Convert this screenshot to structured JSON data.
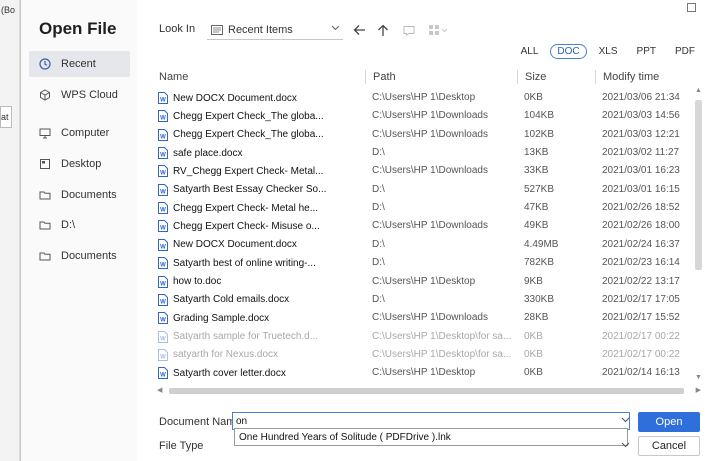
{
  "background_app": {
    "title_fragment": "(Bo",
    "field_fragment": "at"
  },
  "dialog": {
    "title": "Open File"
  },
  "sidebar": {
    "items": [
      {
        "label": "Recent",
        "icon": "clock-icon",
        "active": true
      },
      {
        "label": "WPS Cloud",
        "icon": "cube-icon",
        "active": false
      },
      {
        "label": "Computer",
        "icon": "monitor-icon",
        "active": false
      },
      {
        "label": "Desktop",
        "icon": "desktop-icon",
        "active": false
      },
      {
        "label": "Documents",
        "icon": "folder-icon",
        "active": false
      },
      {
        "label": "D:\\",
        "icon": "folder-icon",
        "active": false
      },
      {
        "label": "Documents",
        "icon": "folder-icon",
        "active": false
      }
    ]
  },
  "toolbar": {
    "look_in_label": "Look In",
    "look_in_value": "Recent Items",
    "back_icon": "arrow-left-icon",
    "up_icon": "arrow-up-icon",
    "new_folder_icon": "new-folder-icon",
    "view_icon": "view-grid-icon"
  },
  "filters": [
    "ALL",
    "DOC",
    "XLS",
    "PPT",
    "PDF"
  ],
  "active_filter": "DOC",
  "columns": {
    "name": "Name",
    "path": "Path",
    "size": "Size",
    "modified": "Modify time"
  },
  "files": [
    {
      "name": "New DOCX Document.docx",
      "path": "C:\\Users\\HP 1\\Desktop",
      "size": "0KB",
      "modified": "2021/03/06 21:34",
      "dim": false
    },
    {
      "name": "Chegg Expert Check_The globa...",
      "path": "C:\\Users\\HP 1\\Downloads",
      "size": "104KB",
      "modified": "2021/03/03 14:56",
      "dim": false
    },
    {
      "name": "Chegg Expert Check_The globa...",
      "path": "C:\\Users\\HP 1\\Downloads",
      "size": "102KB",
      "modified": "2021/03/03 12:21",
      "dim": false
    },
    {
      "name": "safe place.docx",
      "path": "D:\\",
      "size": "13KB",
      "modified": "2021/03/02 11:27",
      "dim": false
    },
    {
      "name": "RV_Chegg Expert Check- Metal...",
      "path": "C:\\Users\\HP 1\\Downloads",
      "size": "33KB",
      "modified": "2021/03/01 16:23",
      "dim": false
    },
    {
      "name": "Satyarth Best Essay Checker So...",
      "path": "D:\\",
      "size": "527KB",
      "modified": "2021/03/01 16:15",
      "dim": false
    },
    {
      "name": "Chegg Expert Check- Metal he...",
      "path": "D:\\",
      "size": "47KB",
      "modified": "2021/02/26 18:52",
      "dim": false
    },
    {
      "name": "Chegg Expert Check- Misuse o...",
      "path": "C:\\Users\\HP 1\\Downloads",
      "size": "49KB",
      "modified": "2021/02/26 18:00",
      "dim": false
    },
    {
      "name": "New DOCX Document.docx",
      "path": "D:\\",
      "size": "4.49MB",
      "modified": "2021/02/24 16:37",
      "dim": false
    },
    {
      "name": "Satyarth best of online writing-...",
      "path": "D:\\",
      "size": "782KB",
      "modified": "2021/02/23 16:14",
      "dim": false
    },
    {
      "name": "how to.doc",
      "path": "C:\\Users\\HP 1\\Desktop",
      "size": "9KB",
      "modified": "2021/02/22 13:17",
      "dim": false
    },
    {
      "name": "Satyarth Cold emails.docx",
      "path": "D:\\",
      "size": "330KB",
      "modified": "2021/02/17 17:05",
      "dim": false
    },
    {
      "name": "Grading Sample.docx",
      "path": "C:\\Users\\HP 1\\Downloads",
      "size": "28KB",
      "modified": "2021/02/17 15:52",
      "dim": false
    },
    {
      "name": "Satyarth sample for Truetech.d...",
      "path": "C:\\Users\\HP 1\\Desktop\\for sa...",
      "size": "0KB",
      "modified": "2021/02/17 00:22",
      "dim": true
    },
    {
      "name": "satyarth for Nexus.docx",
      "path": "C:\\Users\\HP 1\\Desktop\\for sa...",
      "size": "0KB",
      "modified": "2021/02/17 00:22",
      "dim": true
    },
    {
      "name": "Satyarth cover letter.docx",
      "path": "C:\\Users\\HP 1\\Desktop",
      "size": "0KB",
      "modified": "2021/02/14 16:13",
      "dim": false
    }
  ],
  "document_name": {
    "label": "Document Name",
    "value": "on",
    "suggestion": "One Hundred Years of Solitude ( PDFDrive ).lnk"
  },
  "file_type": {
    "label": "File Type"
  },
  "buttons": {
    "open": "Open",
    "cancel": "Cancel"
  },
  "colors": {
    "accent": "#2e6fdc",
    "file_icon": "#2f64c9"
  }
}
